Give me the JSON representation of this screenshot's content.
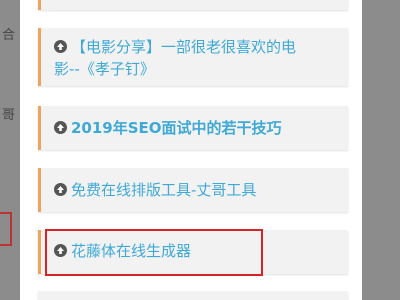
{
  "background": {
    "left_fragment_1": "合",
    "left_fragment_2": "哥"
  },
  "articles": [
    {
      "title_line1": "【电影分享】一部很老很喜欢的电",
      "title_line2": "影--《孝子钉》",
      "bold": false
    },
    {
      "title_line1": "2019年SEO面试中的若干技巧",
      "bold": true
    },
    {
      "title_line1": "免费在线排版工具-丈哥工具",
      "bold": false
    },
    {
      "title_line1": "花藤体在线生成器",
      "bold": false,
      "highlighted": true
    }
  ],
  "colors": {
    "accent": "#f0a35e",
    "link": "#3fa9d6",
    "highlight_border": "#d7232a",
    "icon": "#555555"
  },
  "icons": {
    "article_icon": "arrow-up-circle-icon"
  }
}
